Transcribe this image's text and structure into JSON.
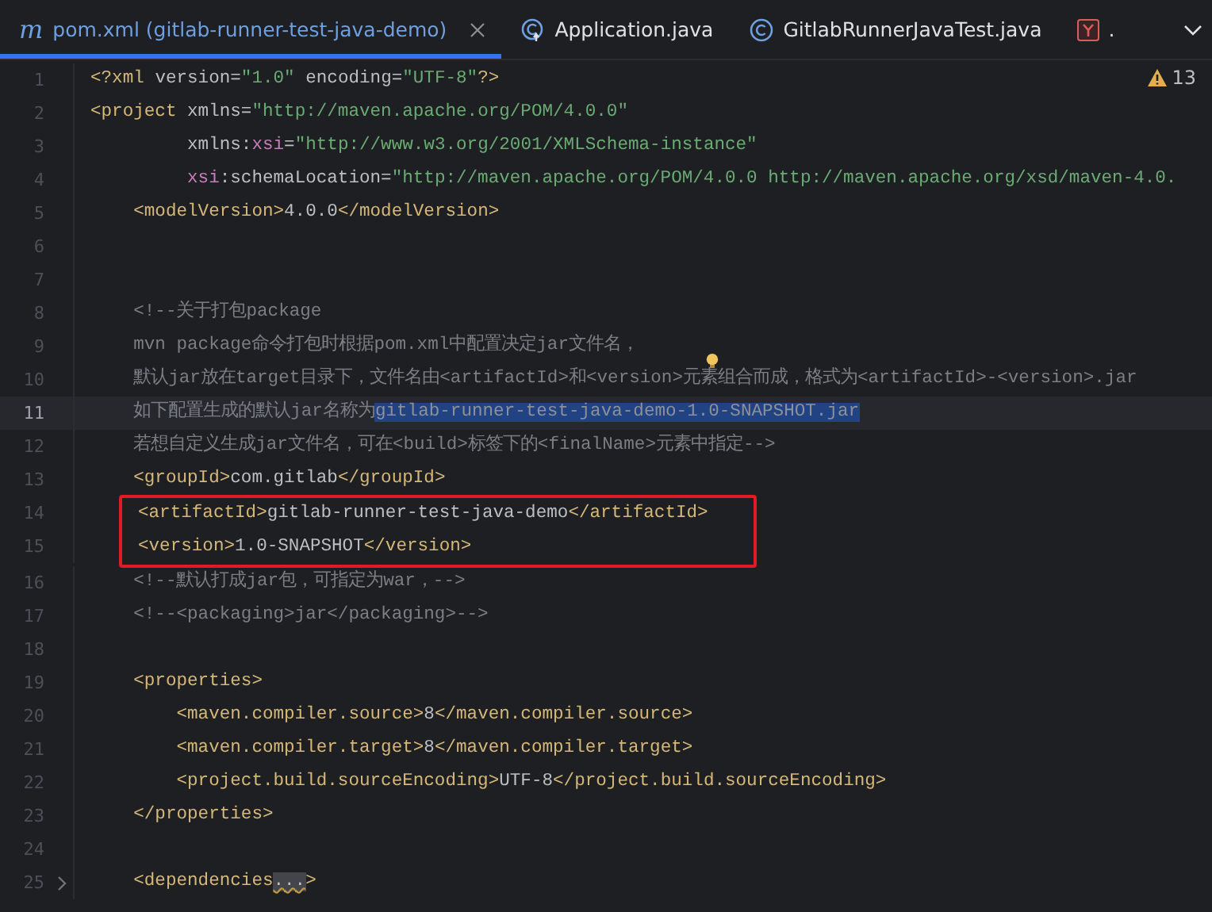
{
  "tabs": [
    {
      "label": "pom.xml (gitlab-runner-test-java-demo)",
      "kind": "maven",
      "icon_glyph": "m",
      "selected": true,
      "closable": true
    },
    {
      "label": "Application.java",
      "kind": "app-class",
      "selected": false,
      "closable": false
    },
    {
      "label": "GitlabRunnerJavaTest.java",
      "kind": "class",
      "selected": false,
      "closable": false
    },
    {
      "label": ".",
      "kind": "yaml",
      "selected": false,
      "closable": false
    }
  ],
  "inspection": {
    "count": "13"
  },
  "lines": [
    {
      "number": "1",
      "current": false,
      "boxed": false,
      "tokens": [
        {
          "kind": "tag",
          "text": "<?xml "
        },
        {
          "kind": "attr",
          "text": "version="
        },
        {
          "kind": "str",
          "text": "\"1.0\" "
        },
        {
          "kind": "attr",
          "text": "encoding="
        },
        {
          "kind": "str",
          "text": "\"UTF-8\""
        },
        {
          "kind": "tag",
          "text": "?>"
        }
      ]
    },
    {
      "number": "2",
      "current": false,
      "boxed": false,
      "tokens": [
        {
          "kind": "tag",
          "text": "<project "
        },
        {
          "kind": "attr",
          "text": "xmlns="
        },
        {
          "kind": "str",
          "text": "\"http://maven.apache.org/POM/4.0.0\""
        }
      ]
    },
    {
      "number": "3",
      "current": false,
      "boxed": false,
      "tokens": [
        {
          "kind": "attr",
          "text": "         xmlns:"
        },
        {
          "kind": "ns",
          "text": "xsi"
        },
        {
          "kind": "attr",
          "text": "="
        },
        {
          "kind": "str",
          "text": "\"http://www.w3.org/2001/XMLSchema-instance\""
        }
      ]
    },
    {
      "number": "4",
      "current": false,
      "boxed": false,
      "tokens": [
        {
          "kind": "ns",
          "text": "         xsi"
        },
        {
          "kind": "attr",
          "text": ":schemaLocation="
        },
        {
          "kind": "str",
          "text": "\"http://maven.apache.org/POM/4.0.0 http://maven.apache.org/xsd/maven-4.0."
        }
      ]
    },
    {
      "number": "5",
      "current": false,
      "boxed": false,
      "tokens": [
        {
          "kind": "tag",
          "text": "    <modelVersion>"
        },
        {
          "kind": "text",
          "text": "4.0.0"
        },
        {
          "kind": "tag",
          "text": "</modelVersion>"
        }
      ]
    },
    {
      "number": "6",
      "current": false,
      "boxed": false
    },
    {
      "number": "7",
      "current": false,
      "boxed": false
    },
    {
      "number": "8",
      "current": false,
      "boxed": false,
      "tokens": [
        {
          "kind": "comment",
          "text": "    <!--关于打包package"
        }
      ]
    },
    {
      "number": "9",
      "current": false,
      "boxed": false,
      "tokens": [
        {
          "kind": "comment",
          "text": "    mvn package命令打包时根据pom.xml中配置决定jar文件名，"
        }
      ]
    },
    {
      "number": "10",
      "current": false,
      "boxed": false,
      "bulb": true,
      "tokens": [
        {
          "kind": "comment",
          "text": "    默认jar放在target目录下，文件名由<artifactId>和<version>元素组合而成，格式为<artifactId>-<version>.jar"
        }
      ]
    },
    {
      "number": "11",
      "current": true,
      "boxed": false,
      "tokens": [
        {
          "kind": "comment",
          "text": "    如下配置生成的默认jar名称为"
        },
        {
          "kind": "selection",
          "text": "gitlab-runner-test-java-demo-1.0-SNAPSHOT.jar"
        }
      ]
    },
    {
      "number": "12",
      "current": false,
      "boxed": false,
      "tokens": [
        {
          "kind": "comment",
          "text": "    若想自定义生成jar文件名，可在<build>标签下的<finalName>元素中指定-->"
        }
      ]
    },
    {
      "number": "13",
      "current": false,
      "boxed": false,
      "tokens": [
        {
          "kind": "tag",
          "text": "    <groupId>"
        },
        {
          "kind": "text",
          "text": "com.gitlab"
        },
        {
          "kind": "tag",
          "text": "</groupId>"
        }
      ]
    },
    {
      "number": "14",
      "current": false,
      "boxed": true,
      "tokens": [
        {
          "kind": "tag",
          "text": "<artifactId>"
        },
        {
          "kind": "text",
          "text": "gitlab-runner-test-java-demo"
        },
        {
          "kind": "tag",
          "text": "</artifactId>"
        }
      ]
    },
    {
      "number": "15",
      "current": false,
      "boxed": true,
      "tokens": [
        {
          "kind": "tag",
          "text": "<version>"
        },
        {
          "kind": "text",
          "text": "1.0-SNAPSHOT"
        },
        {
          "kind": "tag",
          "text": "</version>"
        }
      ]
    },
    {
      "number": "16",
      "current": false,
      "boxed": false,
      "tokens": [
        {
          "kind": "comment",
          "text": "    <!--默认打成jar包，可指定为war，-->"
        }
      ]
    },
    {
      "number": "17",
      "current": false,
      "boxed": false,
      "tokens": [
        {
          "kind": "comment",
          "text": "    <!--<packaging>jar</packaging>-->"
        }
      ]
    },
    {
      "number": "18",
      "current": false,
      "boxed": false
    },
    {
      "number": "19",
      "current": false,
      "boxed": false,
      "tokens": [
        {
          "kind": "tag",
          "text": "    <properties>"
        }
      ]
    },
    {
      "number": "20",
      "current": false,
      "boxed": false,
      "tokens": [
        {
          "kind": "tag",
          "text": "        <maven.compiler.source>"
        },
        {
          "kind": "text",
          "text": "8"
        },
        {
          "kind": "tag",
          "text": "</maven.compiler.source>"
        }
      ]
    },
    {
      "number": "21",
      "current": false,
      "boxed": false,
      "tokens": [
        {
          "kind": "tag",
          "text": "        <maven.compiler.target>"
        },
        {
          "kind": "text",
          "text": "8"
        },
        {
          "kind": "tag",
          "text": "</maven.compiler.target>"
        }
      ]
    },
    {
      "number": "22",
      "current": false,
      "boxed": false,
      "tokens": [
        {
          "kind": "tag",
          "text": "        <project.build.sourceEncoding>"
        },
        {
          "kind": "text",
          "text": "UTF-8"
        },
        {
          "kind": "tag",
          "text": "</project.build.sourceEncoding>"
        }
      ]
    },
    {
      "number": "23",
      "current": false,
      "boxed": false,
      "tokens": [
        {
          "kind": "tag",
          "text": "    </properties>"
        }
      ]
    },
    {
      "number": "24",
      "current": false,
      "boxed": false
    },
    {
      "number": "25",
      "current": false,
      "boxed": false,
      "folded": true,
      "tokens": [
        {
          "kind": "tag",
          "text": "    <dependencies"
        },
        {
          "kind": "fold",
          "text": "..."
        },
        {
          "kind": "tag",
          "text": ">"
        }
      ]
    }
  ]
}
